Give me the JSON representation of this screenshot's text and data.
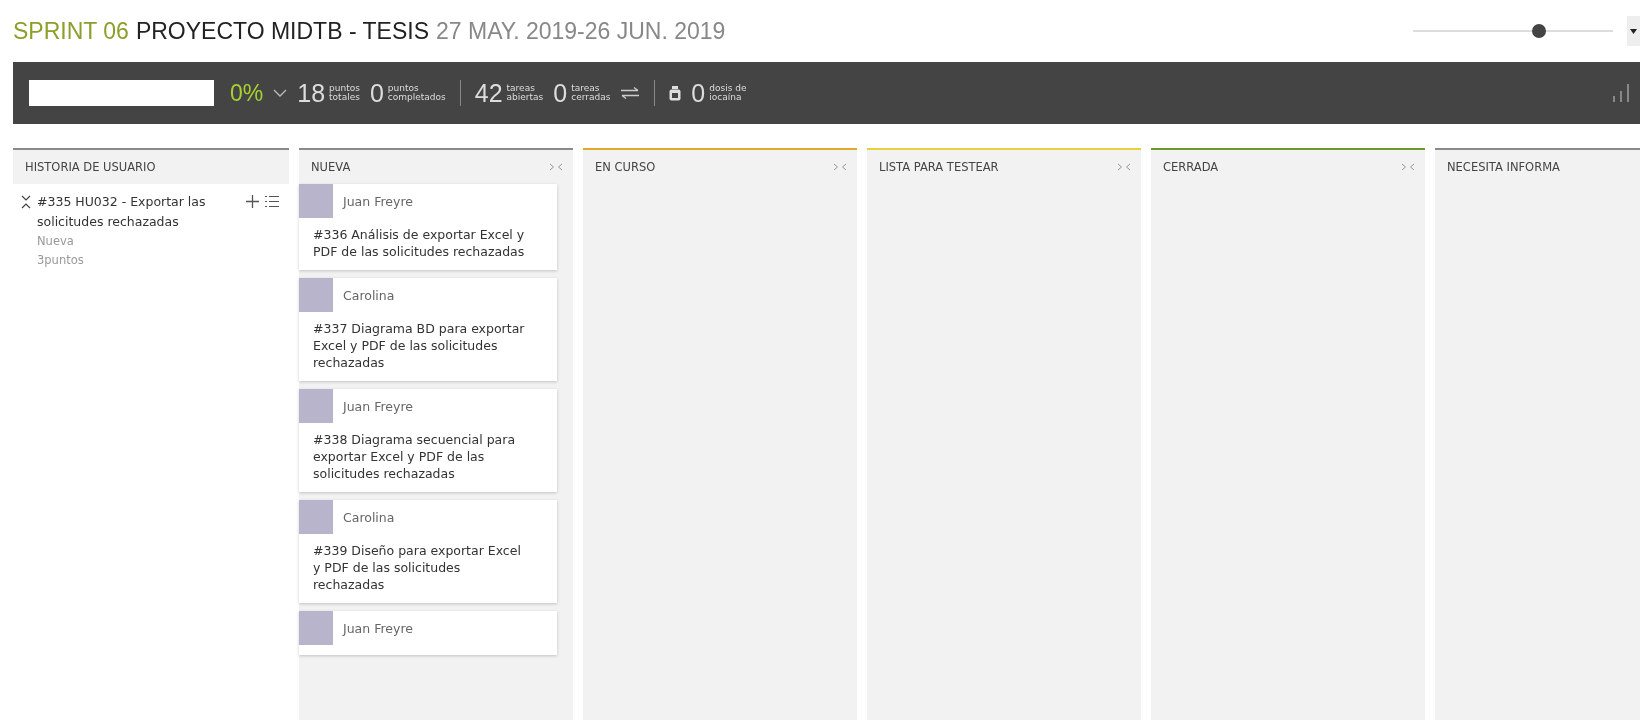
{
  "header": {
    "sprint": "SPRINT 06",
    "project": "PROYECTO MIDTB - TESIS",
    "dates": "27 MAY. 2019-26 JUN. 2019"
  },
  "zoom_slider": {
    "level": 0.63
  },
  "toolbar": {
    "progress": {
      "level": 0,
      "percent": "0%"
    },
    "points": [
      {
        "value": "18",
        "label": [
          "puntos",
          "totales"
        ]
      },
      {
        "value": "0",
        "label": [
          "puntos",
          "completados"
        ]
      }
    ],
    "tasks": [
      {
        "value": "42",
        "label": [
          "tareas",
          "abiertas"
        ]
      },
      {
        "value": "0",
        "label": [
          "tareas",
          "cerradas"
        ]
      }
    ],
    "doses": {
      "value": "0",
      "label": [
        "dosis de",
        "iocaína"
      ]
    }
  },
  "story_column": {
    "title": "HISTORIA DE USUARIO",
    "color": "#8a8a8a"
  },
  "story": {
    "expanded": true,
    "title": "#335 HU032 - Exportar las solicitudes rechazadas",
    "status": "Nueva",
    "points": "3puntos"
  },
  "columns": [
    {
      "title": "NUEVA",
      "color": "#8a8a8a",
      "cards": [
        {
          "author": "Juan Freyre",
          "text": "#336 Análisis de exportar Excel y PDF de las solicitudes rechazadas"
        },
        {
          "author": "Carolina",
          "text": "#337 Diagrama BD para exportar Excel y PDF de las solicitudes rechazadas"
        },
        {
          "author": "Juan Freyre",
          "text": "#338 Diagrama secuencial para exportar Excel y PDF de las solicitudes rechazadas"
        },
        {
          "author": "Carolina",
          "text": "#339 Diseño para exportar Excel y PDF de las solicitudes rechazadas"
        },
        {
          "author": "Juan Freyre"
        }
      ]
    },
    {
      "title": "EN CURSO",
      "color": "#e0a82e"
    },
    {
      "title": "LISTA PARA TESTEAR",
      "color": "#e8d23a"
    },
    {
      "title": "CERRADA",
      "color": "#6a9a2a"
    },
    {
      "title": "NECESITA INFORMA",
      "color": "#8a8a8a"
    }
  ]
}
